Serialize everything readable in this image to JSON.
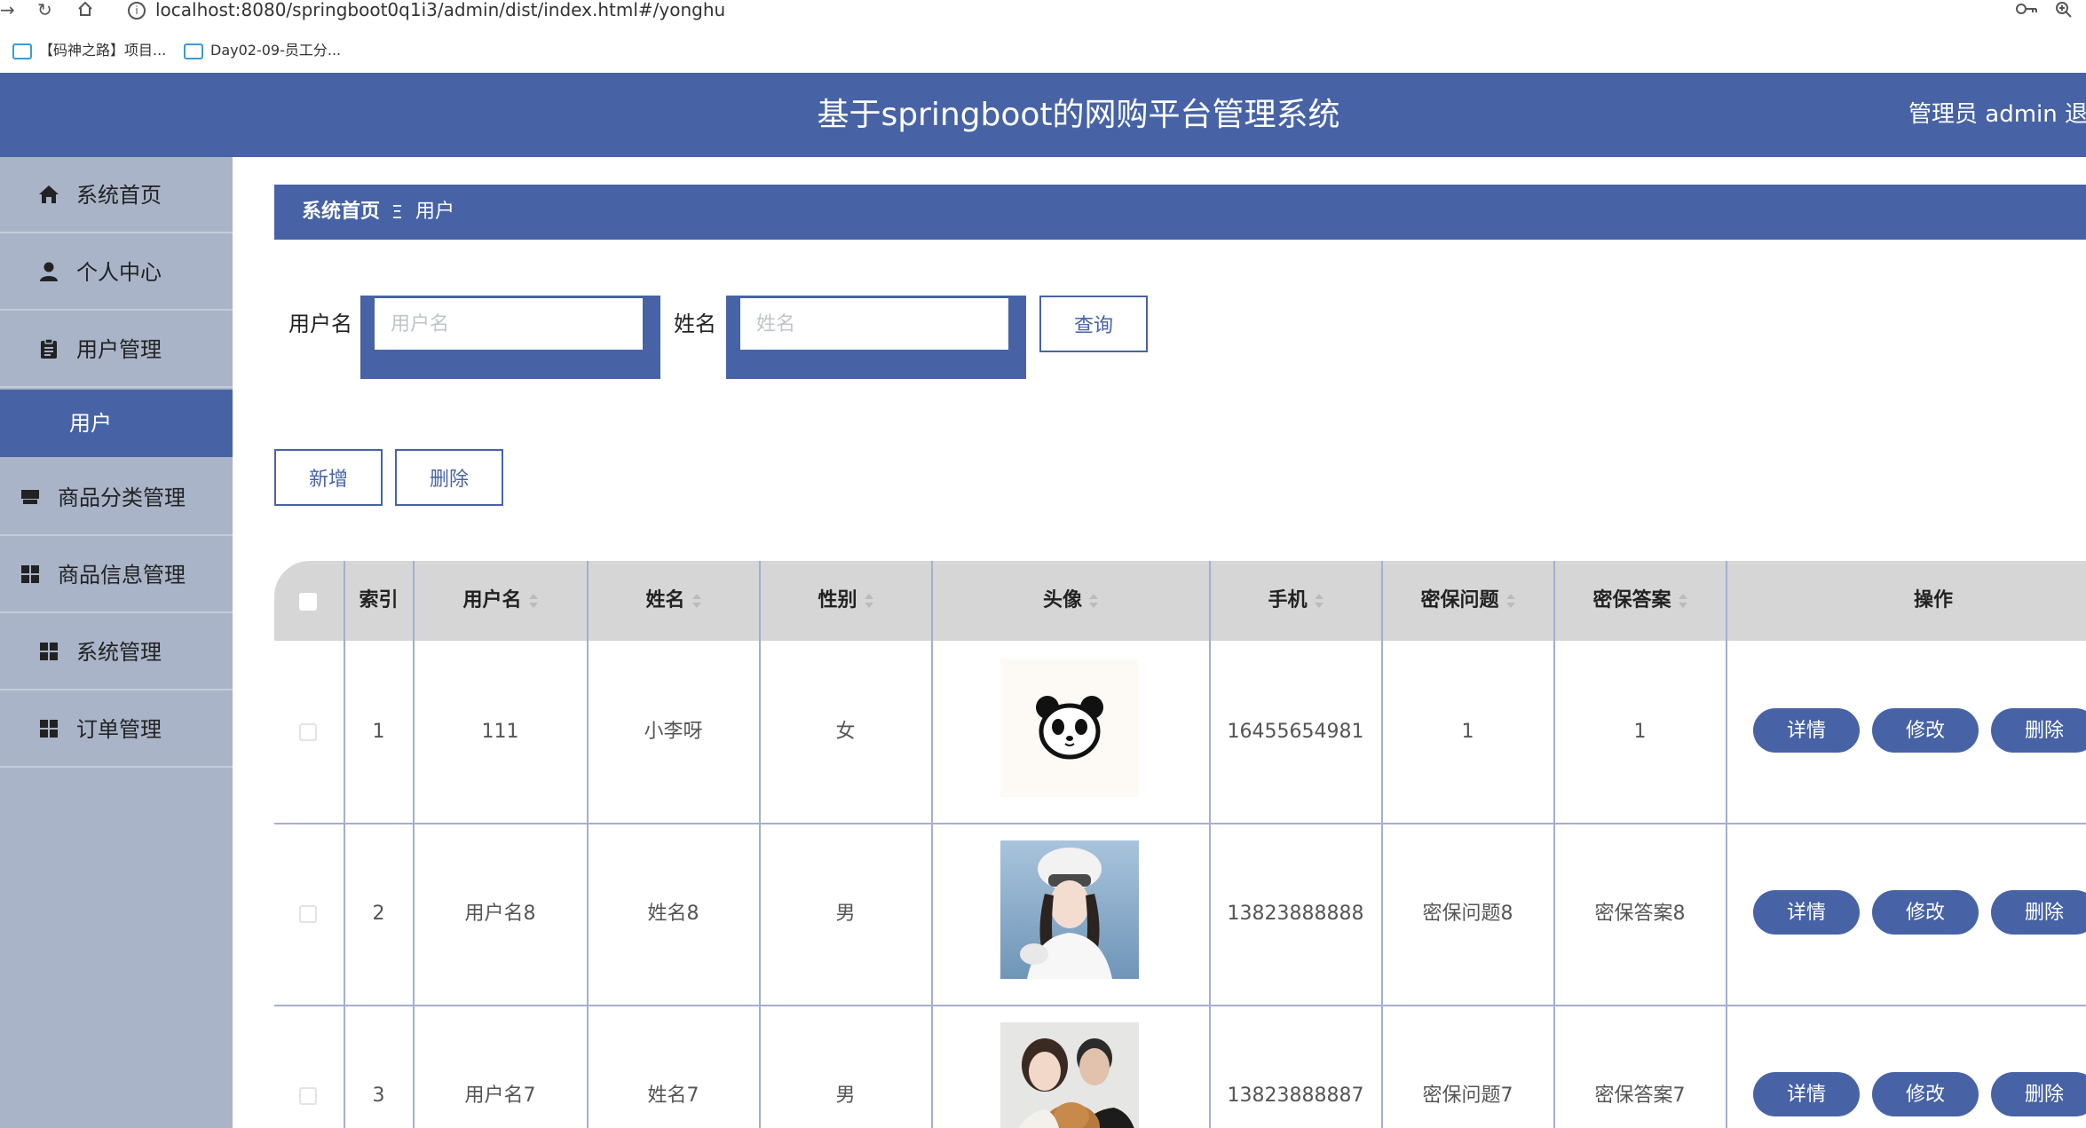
{
  "browser": {
    "url": "localhost:8080/springboot0q1i3/admin/dist/index.html#/yonghu",
    "bookmarks": [
      "【码神之路】项目...",
      "Day02-09-员工分..."
    ]
  },
  "header": {
    "title": "基于springboot的网购平台管理系统",
    "user_info": "管理员 admin  退"
  },
  "sidebar": {
    "items": [
      {
        "label": "系统首页",
        "icon": "home-icon"
      },
      {
        "label": "个人中心",
        "icon": "person-icon"
      },
      {
        "label": "用户管理",
        "icon": "clipboard-icon"
      },
      {
        "label": "用户",
        "icon": ""
      },
      {
        "label": "商品分类管理",
        "icon": "store-icon"
      },
      {
        "label": "商品信息管理",
        "icon": "grid-icon"
      },
      {
        "label": "系统管理",
        "icon": "grid-icon"
      },
      {
        "label": "订单管理",
        "icon": "grid-icon"
      }
    ]
  },
  "breadcrumb": {
    "home": "系统首页",
    "separator": "Ξ",
    "current": "用户"
  },
  "search": {
    "username_label": "用户名",
    "username_placeholder": "用户名",
    "username_value": "",
    "name_label": "姓名",
    "name_placeholder": "姓名",
    "name_value": "",
    "query_button": "查询"
  },
  "actions": {
    "add_button": "新增",
    "delete_button": "删除"
  },
  "table": {
    "columns": [
      "索引",
      "用户名",
      "姓名",
      "性别",
      "头像",
      "手机",
      "密保问题",
      "密保答案",
      "操作"
    ],
    "rows": [
      {
        "index": "1",
        "username": "111",
        "name": "小李呀",
        "gender": "女",
        "phone": "16455654981",
        "question": "1",
        "answer": "1"
      },
      {
        "index": "2",
        "username": "用户名8",
        "name": "姓名8",
        "gender": "男",
        "phone": "13823888888",
        "question": "密保问题8",
        "answer": "密保答案8"
      },
      {
        "index": "3",
        "username": "用户名7",
        "name": "姓名7",
        "gender": "男",
        "phone": "13823888887",
        "question": "密保问题7",
        "answer": "密保答案7"
      }
    ],
    "row_buttons": {
      "detail": "详情",
      "edit": "修改",
      "delete": "删除"
    }
  },
  "colors": {
    "primary": "#4763a5",
    "sidebar_bg": "#a9b4c8",
    "table_header_bg": "#d6d6d6",
    "grid_line": "#a5aed0"
  }
}
